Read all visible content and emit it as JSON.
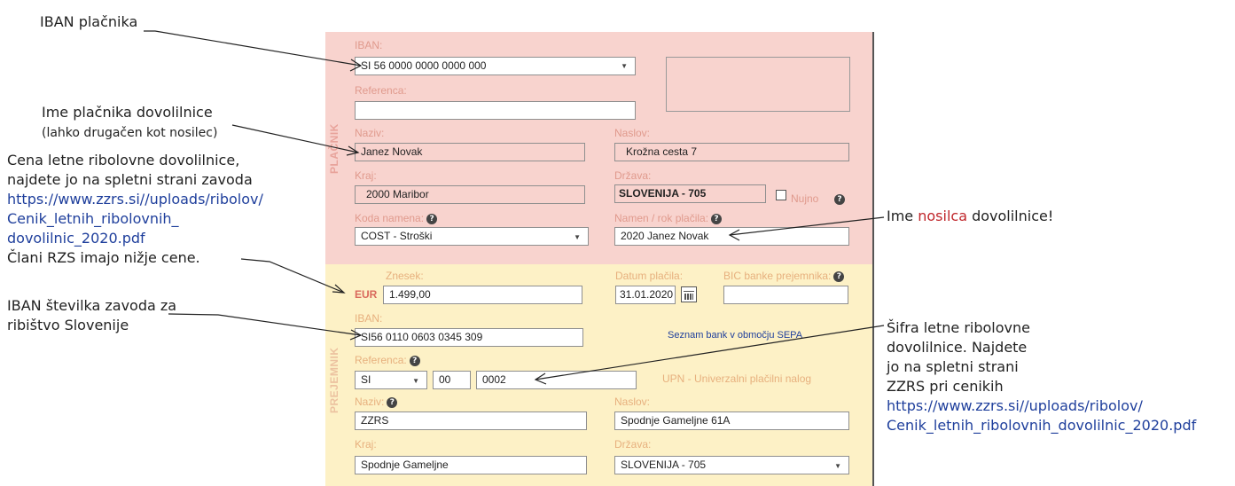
{
  "annotations": {
    "iban_payer": "IBAN plačnika",
    "payer_name_1": "Ime plačnika dovolilnice",
    "payer_name_2": "(lahko drugačen kot nosilec)",
    "price_1": "Cena letne ribolovne dovolilnice,",
    "price_2": "najdete jo na spletni strani zavoda",
    "price_link_1": "https://www.zzrs.si//uploads/ribolov/",
    "price_link_2": "Cenik_letnih_ribolovnih_",
    "price_link_3": "dovolilnic_2020.pdf",
    "price_4": "Člani RZS imajo nižje cene.",
    "iban_inst_1": "IBAN številka zavoda za",
    "iban_inst_2": "ribištvo Slovenije",
    "holder_pre": "Ime ",
    "holder_red": "nosilca",
    "holder_post": " dovolilnice!",
    "code_1": "Šifra letne ribolovne",
    "code_2": "dovolilnice. Najdete",
    "code_3": "jo na spletni strani",
    "code_4": "ZZRS pri cenikih",
    "code_link_1": "https://www.zzrs.si//uploads/ribolov/",
    "code_link_2": "Cenik_letnih_ribolovnih_dovolilnic_2020.pdf"
  },
  "payer": {
    "side_label": "PLAČNIK",
    "iban_label": "IBAN:",
    "iban_value": "SI 56 0000 0000 0000 000",
    "reference_label": "Referenca:",
    "reference_value": "",
    "name_label": "Naziv:",
    "name_value": "Janez Novak",
    "address_label": "Naslov:",
    "address_value": "Krožna cesta 7",
    "city_label": "Kraj:",
    "city_value": "2000 Maribor",
    "country_label": "Država:",
    "country_value": "SLOVENIJA - 705",
    "urgent_label": "Nujno",
    "purpose_code_label": "Koda namena:",
    "purpose_code_value": "COST - Stroški",
    "purpose_label": "Namen / rok plačila:",
    "purpose_value": "2020 Janez Novak"
  },
  "payee": {
    "side_label": "PREJEMNIK",
    "amount_label": "Znesek:",
    "currency": "EUR",
    "amount_value": "1.499,00",
    "date_label": "Datum plačila:",
    "date_value": "31.01.2020",
    "bic_label": "BIC banke prejemnika:",
    "bic_value": "",
    "iban_label": "IBAN:",
    "iban_value": "SI56 0110 0603 0345 309",
    "sepa_link": "Seznam bank v območju SEPA",
    "reference_label": "Referenca:",
    "ref_model": "SI",
    "ref_part1": "00",
    "ref_part2": "0002",
    "upn_label": "UPN - Univerzalni plačilni nalog",
    "name_label": "Naziv:",
    "name_value": "ZZRS",
    "address_label": "Naslov:",
    "address_value": "Spodnje Gameljne 61A",
    "city_label": "Kraj:",
    "city_value": "Spodnje Gameljne",
    "country_label": "Država:",
    "country_value": "SLOVENIJA - 705"
  },
  "icons": {
    "help": "?",
    "dropdown": "▼"
  },
  "colors": {
    "payer_bg": "#f8d3ce",
    "payee_bg": "#fdf1c6",
    "link": "#1f3f9c",
    "highlight": "#c0262b"
  }
}
